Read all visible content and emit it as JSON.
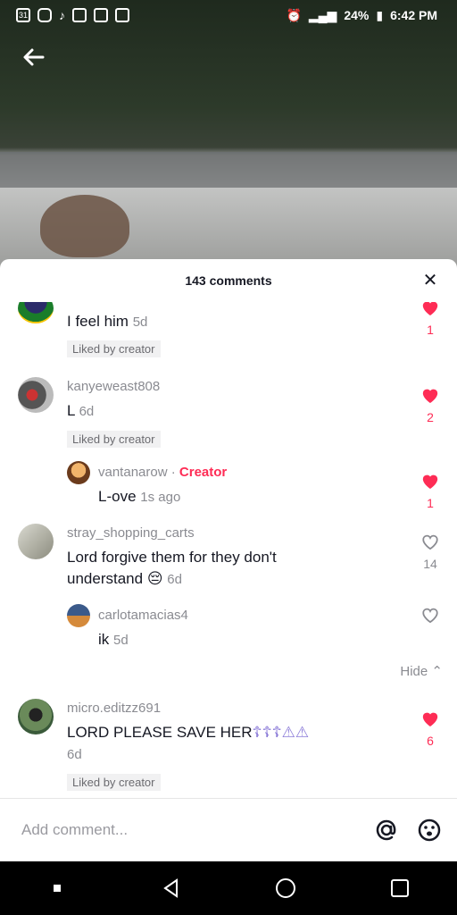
{
  "status": {
    "battery": "24%",
    "time": "6:42 PM",
    "calendar_day": "31"
  },
  "colors": {
    "accent": "#fe2c55",
    "text": "#161823",
    "muted": "#8a8b91"
  },
  "header": {
    "title": "143 comments"
  },
  "comments": [
    {
      "text": "I feel him",
      "time": "5d",
      "liked_badge": "Liked by creator",
      "likes": "1",
      "liked": true
    },
    {
      "username": "kanyeweast808",
      "text": "L",
      "time": "6d",
      "liked_badge": "Liked by creator",
      "likes": "2",
      "liked": true
    },
    {
      "username": "vantanarow",
      "creator_tag": "Creator",
      "text": "L-ove",
      "time": "1s ago",
      "likes": "1",
      "liked": true
    },
    {
      "username": "stray_shopping_carts",
      "text_line1": "Lord forgive them for they don't",
      "text_line2": "understand",
      "emoji": "😔",
      "time": "6d",
      "likes": "14",
      "liked": false
    },
    {
      "username": "carlotamacias4",
      "text": "ik",
      "time": "5d",
      "likes": "",
      "liked": false
    },
    {
      "username": "micro.editzz691",
      "text": "LORD PLEASE SAVE HER",
      "symbols": "☦☦☦⚠⚠",
      "time": "6d",
      "liked_badge": "Liked by creator",
      "likes": "6",
      "liked": true
    }
  ],
  "hide_label": "Hide",
  "add_comment": {
    "placeholder": "Add comment..."
  }
}
